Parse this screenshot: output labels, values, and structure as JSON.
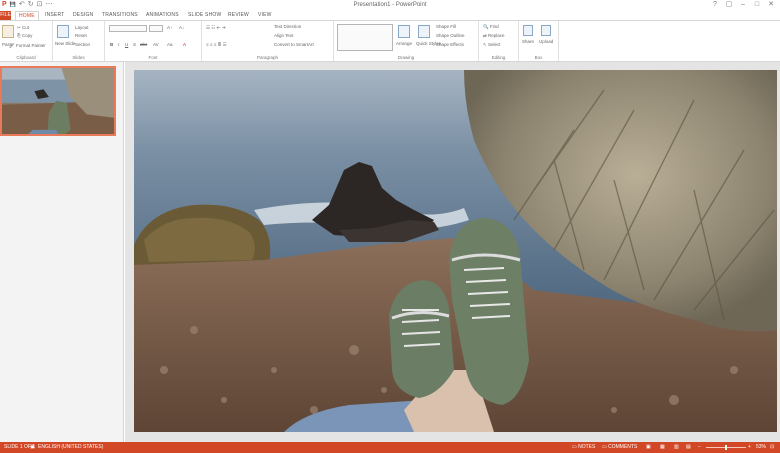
{
  "window": {
    "title": "Presentation1 - PowerPoint"
  },
  "qat": {
    "save_icon": "💾",
    "undo_icon": "↶",
    "redo_icon": "↻",
    "present_icon": "⊡",
    "more_icon": "⋯"
  },
  "window_buttons": {
    "help": "?",
    "restore": "▢",
    "minimize": "–",
    "maximize": "□",
    "close": "✕"
  },
  "tabs": {
    "file": "FILE",
    "items": [
      "HOME",
      "INSERT",
      "DESIGN",
      "TRANSITIONS",
      "ANIMATIONS",
      "SLIDE SHOW",
      "REVIEW",
      "VIEW"
    ]
  },
  "ribbon": {
    "clipboard": {
      "label": "Clipboard",
      "paste": "Paste",
      "cut": "Cut",
      "copy": "Copy",
      "format_painter": "Format Painter"
    },
    "slides": {
      "label": "Slides",
      "new_slide": "New Slide",
      "layout": "Layout",
      "reset": "Reset",
      "section": "Section"
    },
    "font": {
      "label": "Font",
      "bold": "B",
      "italic": "I",
      "underline": "U",
      "strike": "S",
      "shadow": "abc",
      "spacing": "AV",
      "case": "Aa",
      "color": "A"
    },
    "paragraph": {
      "label": "Paragraph",
      "text_direction": "Text Direction",
      "align_text": "Align Text",
      "convert_smartart": "Convert to SmartArt"
    },
    "drawing": {
      "label": "Drawing",
      "arrange": "Arrange",
      "quick_styles": "Quick Styles",
      "shape_fill": "Shape Fill",
      "shape_outline": "Shape Outline",
      "shape_effects": "Shape Effects"
    },
    "editing": {
      "label": "Editing",
      "find": "Find",
      "replace": "Replace",
      "select": "Select"
    },
    "box": {
      "label": "Box",
      "share": "Share",
      "upload": "Upload"
    }
  },
  "slides_pane": {
    "slide_number": "1"
  },
  "status": {
    "slide_of": "SLIDE 1 OF 1",
    "language": "ENGLISH (UNITED STATES)",
    "notes": "NOTES",
    "comments": "COMMENTS",
    "zoom": "53%",
    "zoom_minus": "−",
    "zoom_plus": "+"
  },
  "colors": {
    "accent": "#d24726"
  }
}
